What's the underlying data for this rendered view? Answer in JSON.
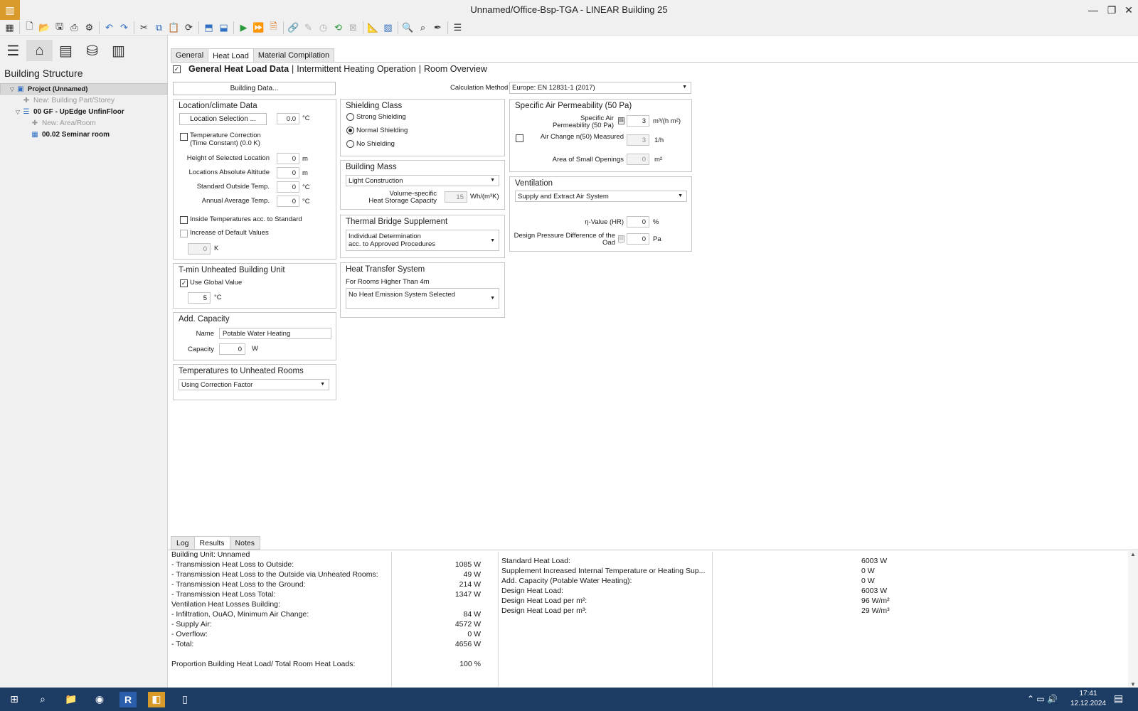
{
  "window": {
    "title": "Unnamed/Office-Bsp-TGA - LINEAR Building 25",
    "min": "—",
    "max": "❐",
    "close": "✕"
  },
  "toolbar": {
    "icons": [
      {
        "name": "apps-grid-icon",
        "glyph": "▦",
        "cls": ""
      },
      {
        "sep": true
      },
      {
        "name": "new-file-icon",
        "glyph": "🗋",
        "cls": ""
      },
      {
        "name": "open-folder-icon",
        "glyph": "📂",
        "cls": "org"
      },
      {
        "name": "save-icon",
        "glyph": "🖫",
        "cls": ""
      },
      {
        "name": "print-icon",
        "glyph": "⎙",
        "cls": ""
      },
      {
        "name": "settings-gear-icon",
        "glyph": "⚙",
        "cls": ""
      },
      {
        "sep": true
      },
      {
        "name": "undo-icon",
        "glyph": "↶",
        "cls": "blue"
      },
      {
        "name": "redo-icon",
        "glyph": "↷",
        "cls": "blue"
      },
      {
        "sep": true
      },
      {
        "name": "cut-icon",
        "glyph": "✂",
        "cls": ""
      },
      {
        "name": "copy-icon",
        "glyph": "⧉",
        "cls": "blue"
      },
      {
        "name": "paste-icon",
        "glyph": "📋",
        "cls": "dis"
      },
      {
        "name": "refresh-icon",
        "glyph": "⟳",
        "cls": ""
      },
      {
        "sep": true
      },
      {
        "name": "import-icon",
        "glyph": "⬒",
        "cls": "blue"
      },
      {
        "name": "export-icon",
        "glyph": "⬓",
        "cls": "blue"
      },
      {
        "sep": true
      },
      {
        "name": "run-calc-icon",
        "glyph": "▶",
        "cls": "grn"
      },
      {
        "name": "calc-all-icon",
        "glyph": "⏩",
        "cls": "grn"
      },
      {
        "name": "report-icon",
        "glyph": "🗎",
        "cls": "org"
      },
      {
        "sep": true
      },
      {
        "name": "link-icon",
        "glyph": "🔗",
        "cls": "org"
      },
      {
        "name": "edit-pencil-icon",
        "glyph": "✎",
        "cls": "dis"
      },
      {
        "name": "clock-icon",
        "glyph": "◷",
        "cls": "dis"
      },
      {
        "name": "sync-icon",
        "glyph": "⟲",
        "cls": "grn"
      },
      {
        "name": "delete-icon",
        "glyph": "⊠",
        "cls": "dis"
      },
      {
        "sep": true
      },
      {
        "name": "ruler-icon",
        "glyph": "📐",
        "cls": "dis"
      },
      {
        "name": "chart-icon",
        "glyph": "▧",
        "cls": "blue"
      },
      {
        "sep": true
      },
      {
        "name": "search-icon",
        "glyph": "🔍",
        "cls": ""
      },
      {
        "name": "zoom-icon",
        "glyph": "⌕",
        "cls": ""
      },
      {
        "name": "pipette-icon",
        "glyph": "✒",
        "cls": ""
      },
      {
        "sep": true
      },
      {
        "name": "layout-icon",
        "glyph": "☰",
        "cls": ""
      }
    ]
  },
  "sidebar": {
    "icons": [
      {
        "name": "menu-icon",
        "glyph": "☰"
      },
      {
        "name": "building-icon",
        "glyph": "⌂"
      },
      {
        "name": "list-icon",
        "glyph": "▤"
      },
      {
        "name": "database-icon",
        "glyph": "⛁"
      },
      {
        "name": "document-icon",
        "glyph": "▥"
      }
    ],
    "title": "Building Structure",
    "tree": [
      {
        "label": "Project (Unnamed)",
        "indent": 0,
        "tri": "▽",
        "icon": "▣",
        "style": "bold",
        "sel": true
      },
      {
        "label": "New: Building Part/Storey",
        "indent": 1,
        "tri": "",
        "icon": "✚",
        "style": "grey",
        "sel": false
      },
      {
        "label": "00 GF - UpEdge UnfinFloor",
        "indent": 1,
        "tri": "▽",
        "icon": "☰",
        "style": "bold",
        "sel": false
      },
      {
        "label": "New: Area/Room",
        "indent": 2,
        "tri": "",
        "icon": "✚",
        "style": "grey",
        "sel": false
      },
      {
        "label": "00.02 Seminar room",
        "indent": 2,
        "tri": "",
        "icon": "▦",
        "style": "bold",
        "sel": false
      }
    ]
  },
  "tabs": [
    "General",
    "Heat Load",
    "Material Compilation"
  ],
  "active_tab": 1,
  "header": {
    "title": "General Heat Load Data",
    "sep": "|",
    "link1": "Intermittent Heating Operation",
    "link2": "Room Overview",
    "check": "✓"
  },
  "building_data_btn": "Building Data...",
  "calc_method": {
    "label": "Calculation Method",
    "value": "Europe: EN 12831-1 (2017)"
  },
  "location": {
    "title": "Location/climate Data",
    "select_btn": "Location Selection ...",
    "temp": "0.0",
    "temp_unit": "°C",
    "temp_corr": "Temperature Correction",
    "temp_corr2": "(Time Constant) (0.0 K)",
    "rows": [
      {
        "label": "Height of Selected Location",
        "value": "0",
        "unit": "m"
      },
      {
        "label": "Locations Absolute Altitude",
        "value": "0",
        "unit": "m"
      },
      {
        "label": "Standard Outside Temp.",
        "value": "0",
        "unit": "°C"
      },
      {
        "label": "Annual Average Temp.",
        "value": "0",
        "unit": "°C"
      }
    ],
    "inside_temp": "Inside Temperatures acc. to Standard",
    "increase": "Increase of Default Values",
    "inc_value": "0",
    "inc_unit": "K"
  },
  "tmin": {
    "title": "T-min Unheated Building Unit",
    "use_global": "Use Global Value",
    "value": "5",
    "unit": "°C",
    "check": "✓"
  },
  "add_capacity": {
    "title": "Add. Capacity",
    "name_label": "Name",
    "name_value": "Potable Water Heating",
    "cap_label": "Capacity",
    "cap_value": "0",
    "cap_unit": "W"
  },
  "temp_unheated": {
    "title": "Temperatures to Unheated Rooms",
    "value": "Using Correction Factor"
  },
  "shielding": {
    "title": "Shielding Class",
    "options": [
      "Strong Shielding",
      "Normal Shielding",
      "No Shielding"
    ],
    "selected": 1
  },
  "mass": {
    "title": "Building Mass",
    "value": "Light Construction",
    "cap_label1": "Volume-specific",
    "cap_label2": "Heat Storage Capacity",
    "cap_value": "15",
    "cap_unit": "Wh/(m³K)"
  },
  "thermal": {
    "title": "Thermal Bridge Supplement",
    "value1": "Individual Determination",
    "value2": "acc. to Approved Procedures"
  },
  "heat_transfer": {
    "title": "Heat Transfer System",
    "sub": "For Rooms Higher Than 4m",
    "value": "No Heat Emission System Selected"
  },
  "air_perm": {
    "title": "Specific Air Permeability (50 Pa)",
    "sp1": "Specific Air",
    "sp2": "Permeability (50 Pa)",
    "sp_value": "3",
    "sp_unit": "m³/(h m²)",
    "ac_label": "Air Change n(50) Measured",
    "ac_value": "3",
    "ac_unit": "1/h",
    "small_label": "Area of Small Openings",
    "small_value": "0",
    "small_unit": "m²"
  },
  "ventilation": {
    "title": "Ventilation",
    "value": "Supply and Extract Air System",
    "eta_label": "η-Value (HR)",
    "eta_value": "0",
    "eta_unit": "%",
    "dp1": "Design Pressure Difference of the",
    "dp2": "Oad",
    "dp_value": "0",
    "dp_unit": "Pa"
  },
  "bottom_tabs": [
    "Log",
    "Results",
    "Notes"
  ],
  "bottom_active": 1,
  "results_left": [
    {
      "label": "Building Unit: Unnamed",
      "value": ""
    },
    {
      "label": "- Transmission Heat Loss to Outside:",
      "value": "1085 W"
    },
    {
      "label": "- Transmission Heat Loss to the Outside via Unheated Rooms:",
      "value": "49 W"
    },
    {
      "label": "- Transmission Heat Loss to the Ground:",
      "value": "214 W"
    },
    {
      "label": "- Transmission Heat Loss Total:",
      "value": "1347 W"
    },
    {
      "label": "Ventilation Heat Losses Building:",
      "value": ""
    },
    {
      "label": "- Infiltration, OuAO, Minimum Air Change:",
      "value": "84 W"
    },
    {
      "label": "- Supply Air:",
      "value": "4572 W"
    },
    {
      "label": "- Overflow:",
      "value": "0 W"
    },
    {
      "label": "- Total:",
      "value": "4656 W"
    },
    {
      "label": "",
      "value": ""
    },
    {
      "label": "Proportion Building Heat Load/ Total Room Heat Loads:",
      "value": "100 %"
    }
  ],
  "results_right": [
    {
      "label": "Standard Heat Load:",
      "value": "6003 W"
    },
    {
      "label": "Supplement Increased Internal Temperature or Heating Sup...",
      "value": "0 W"
    },
    {
      "label": "Add. Capacity (Potable Water Heating):",
      "value": "0 W"
    },
    {
      "label": "Design Heat Load:",
      "value": "6003 W"
    },
    {
      "label": "Design Heat Load per m²:",
      "value": "96 W/m²"
    },
    {
      "label": "Design Heat Load per m³:",
      "value": "29 W/m³"
    }
  ],
  "taskbar": {
    "apps": [
      {
        "name": "start-icon",
        "glyph": "⊞"
      },
      {
        "name": "search-icon",
        "glyph": "⌕"
      },
      {
        "name": "file-explorer-icon",
        "glyph": "📁"
      },
      {
        "name": "firefox-icon",
        "glyph": "◉"
      },
      {
        "name": "revit-icon",
        "glyph": "R"
      },
      {
        "name": "linear-app-icon",
        "glyph": "◧"
      },
      {
        "name": "document-app-icon",
        "glyph": "▯"
      }
    ],
    "tray": "⌃  ▭  🔊",
    "time": "17:41",
    "date": "12.12.2024",
    "notif": "▤"
  }
}
